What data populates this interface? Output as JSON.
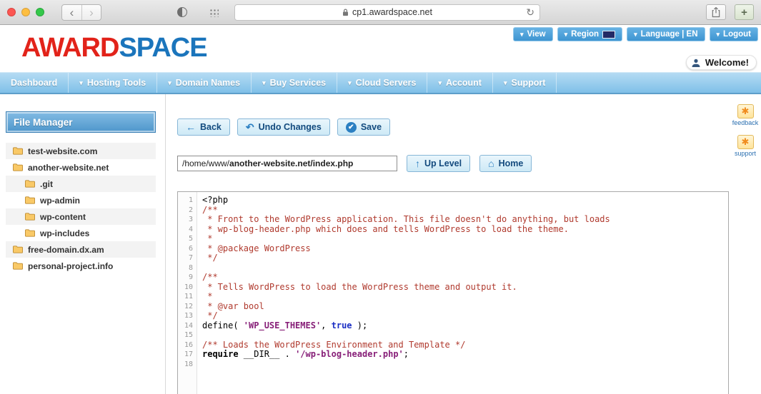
{
  "browser": {
    "url": "cp1.awardspace.net",
    "back_icon": "‹",
    "forward_icon": "›",
    "refresh_icon": "↻",
    "new_tab_label": "+"
  },
  "header": {
    "top_buttons": [
      {
        "id": "view",
        "label": "View",
        "flag": false
      },
      {
        "id": "region",
        "label": "Region",
        "flag": true
      },
      {
        "id": "language",
        "label": "Language | EN",
        "flag": false
      },
      {
        "id": "logout",
        "label": "Logout",
        "flag": false
      }
    ],
    "logo_part1": "AWARD",
    "logo_part2": "SPACE",
    "welcome": "Welcome!"
  },
  "nav": {
    "items": [
      {
        "label": "Dashboard",
        "dropdown": false
      },
      {
        "label": "Hosting Tools",
        "dropdown": true
      },
      {
        "label": "Domain Names",
        "dropdown": true
      },
      {
        "label": "Buy Services",
        "dropdown": true
      },
      {
        "label": "Cloud Servers",
        "dropdown": true
      },
      {
        "label": "Account",
        "dropdown": true
      },
      {
        "label": "Support",
        "dropdown": true
      }
    ]
  },
  "sidebar": {
    "title": "File Manager",
    "items": [
      {
        "label": "test-website.com",
        "indent": 0
      },
      {
        "label": "another-website.net",
        "indent": 0
      },
      {
        "label": ".git",
        "indent": 1
      },
      {
        "label": "wp-admin",
        "indent": 1
      },
      {
        "label": "wp-content",
        "indent": 1
      },
      {
        "label": "wp-includes",
        "indent": 1
      },
      {
        "label": "free-domain.dx.am",
        "indent": 0
      },
      {
        "label": "personal-project.info",
        "indent": 0
      }
    ]
  },
  "toolbar": {
    "back_label": "Back",
    "undo_label": "Undo Changes",
    "save_label": "Save",
    "back_icon": "←",
    "undo_icon": "↶",
    "save_icon": "✔"
  },
  "pathbar": {
    "path_prefix": "/home/www/",
    "path_rest": "another-website.net/index.php",
    "up_label": "Up Level",
    "home_label": "Home",
    "up_icon": "↑",
    "home_icon": "⌂"
  },
  "editor": {
    "lines": [
      {
        "num": 1,
        "segments": [
          {
            "t": "plain",
            "s": "<?php"
          }
        ]
      },
      {
        "num": 2,
        "segments": [
          {
            "t": "comment",
            "s": "/**"
          }
        ]
      },
      {
        "num": 3,
        "segments": [
          {
            "t": "comment",
            "s": " * Front to the WordPress application. This file doesn't do anything, but loads"
          }
        ]
      },
      {
        "num": 4,
        "segments": [
          {
            "t": "comment",
            "s": " * wp-blog-header.php which does and tells WordPress to load the theme."
          }
        ]
      },
      {
        "num": 5,
        "segments": [
          {
            "t": "comment",
            "s": " *"
          }
        ]
      },
      {
        "num": 6,
        "segments": [
          {
            "t": "comment",
            "s": " * @package WordPress"
          }
        ]
      },
      {
        "num": 7,
        "segments": [
          {
            "t": "comment",
            "s": " */"
          }
        ]
      },
      {
        "num": 8,
        "segments": []
      },
      {
        "num": 9,
        "segments": [
          {
            "t": "comment",
            "s": "/**"
          }
        ]
      },
      {
        "num": 10,
        "segments": [
          {
            "t": "comment",
            "s": " * Tells WordPress to load the WordPress theme and output it."
          }
        ]
      },
      {
        "num": 11,
        "segments": [
          {
            "t": "comment",
            "s": " *"
          }
        ]
      },
      {
        "num": 12,
        "segments": [
          {
            "t": "comment",
            "s": " * @var bool"
          }
        ]
      },
      {
        "num": 13,
        "segments": [
          {
            "t": "comment",
            "s": " */"
          }
        ]
      },
      {
        "num": 14,
        "segments": [
          {
            "t": "plain",
            "s": "define( "
          },
          {
            "t": "string",
            "s": "'WP_USE_THEMES'"
          },
          {
            "t": "plain",
            "s": ", "
          },
          {
            "t": "bool",
            "s": "true"
          },
          {
            "t": "plain",
            "s": " );"
          }
        ]
      },
      {
        "num": 15,
        "segments": []
      },
      {
        "num": 16,
        "segments": [
          {
            "t": "comment",
            "s": "/** Loads the WordPress Environment and Template */"
          }
        ]
      },
      {
        "num": 17,
        "segments": [
          {
            "t": "keyword",
            "s": "require"
          },
          {
            "t": "plain",
            "s": " __DIR__ . "
          },
          {
            "t": "string",
            "s": "'/wp-blog-header.php'"
          },
          {
            "t": "plain",
            "s": ";"
          }
        ]
      },
      {
        "num": 18,
        "segments": []
      }
    ]
  },
  "side_badges": [
    {
      "id": "feedback",
      "label": "feedback"
    },
    {
      "id": "support",
      "label": "support"
    }
  ],
  "colors": {
    "brand_red": "#e2231a",
    "brand_blue": "#1b75bc",
    "nav_blue": "#7fc0e8",
    "button_text_blue": "#134a7e",
    "syntax_comment": "#b03a2e",
    "syntax_string": "#871f78",
    "syntax_bool": "#1c2fc4"
  }
}
